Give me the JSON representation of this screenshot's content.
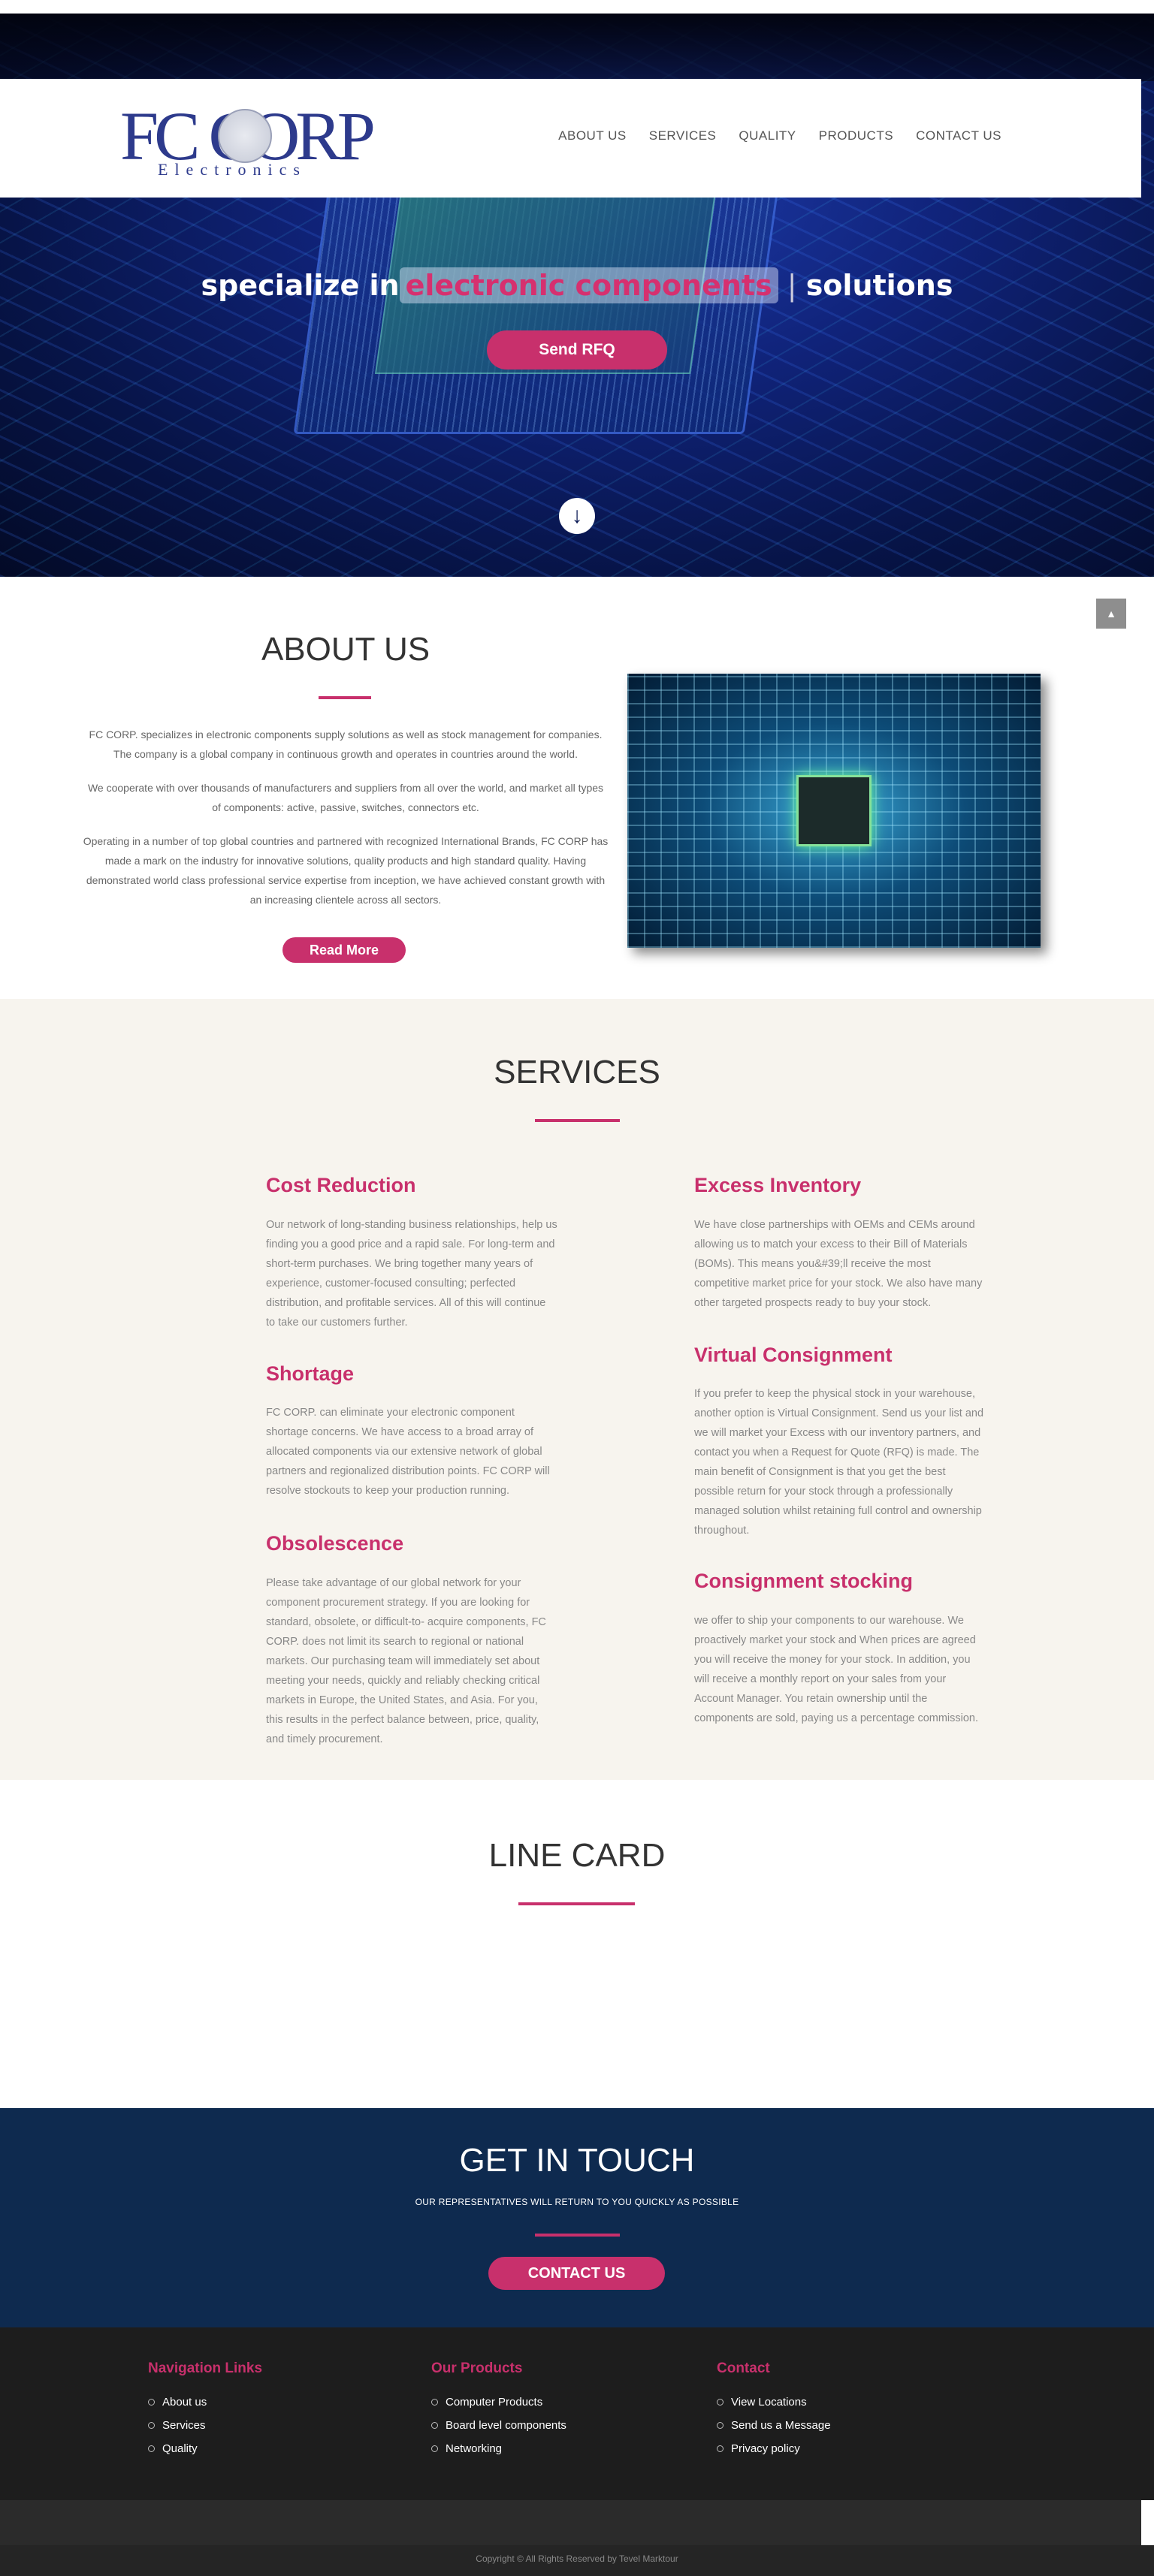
{
  "header": {
    "logo_main": "FC CORP",
    "logo_sub": "Electronics",
    "nav": [
      "ABOUT US",
      "SERVICES",
      "QUALITY",
      "PRODUCTS",
      "CONTACT US"
    ]
  },
  "hero": {
    "title_pre": "specialize in",
    "title_highlight": "electronic components",
    "title_post": "solutions",
    "rfq_button": "Send RFQ",
    "down_icon": "arrow-down-circle"
  },
  "about": {
    "title": "ABOUT US",
    "paragraphs": [
      "FC CORP. specializes in electronic components supply solutions as well as stock management for companies. The company is a global company in continuous growth and operates in countries around the world.",
      "We cooperate with over thousands of manufacturers and suppliers from all over the world, and market all types of components: active, passive, switches, connectors etc.",
      "Operating in a number of top global countries and partnered with recognized International Brands, FC CORP has made a mark on the industry for innovative solutions, quality products and high standard quality. Having demonstrated world class professional service expertise from inception, we have achieved constant growth with an increasing clientele across all sectors."
    ],
    "read_more": "Read More",
    "scroll_top_icon": "chevron-up"
  },
  "services": {
    "title": "SERVICES",
    "left": [
      {
        "title": "Cost Reduction",
        "text": "Our network of long-standing business relationships, help us finding you a good price and a rapid sale. For long-term and short-term purchases. We bring together many years of experience, customer-focused consulting; perfected distribution, and profitable services. All of this will continue to take our customers further."
      },
      {
        "title": "Shortage",
        "text": "FC CORP. can eliminate your electronic component shortage concerns. We have access to a broad array of allocated components via our extensive network of global partners and regionalized distribution points. FC CORP will resolve stockouts to keep your production running."
      },
      {
        "title": "Obsolescence",
        "text": "Please take advantage of our global network for your component procurement strategy. If you are looking for standard, obsolete, or difficult-to- acquire components, FC CORP. does not limit its search to regional or national markets. Our purchasing team will immediately set about meeting your needs, quickly and reliably checking critical markets in Europe, the United States, and Asia. For you, this results in the perfect balance between, price, quality, and timely procurement."
      }
    ],
    "right": [
      {
        "title": "Excess Inventory",
        "text": "We have close partnerships with OEMs and CEMs around allowing us to match your excess to their Bill of Materials (BOMs). This means you&#39;ll receive the most competitive market price for your stock. We also have many other targeted prospects ready to buy your stock."
      },
      {
        "title": "Virtual Consignment",
        "text": "If you prefer to keep the physical stock in your warehouse, another option is Virtual Consignment. Send us your list and we will market your Excess with our inventory partners, and contact you when a Request for Quote (RFQ) is made. The main benefit of Consignment is that you get the best possible return for your stock through a professionally managed solution whilst retaining full control and ownership throughout."
      },
      {
        "title": "Consignment stocking",
        "text": "we offer to ship your components to our warehouse. We proactively market your stock and When prices are agreed you will receive the money for your stock. In addition, you will receive a monthly report on your sales from your Account Manager. You retain ownership until the components are sold, paying us a percentage commission."
      }
    ]
  },
  "linecard": {
    "title": "LINE CARD"
  },
  "contact": {
    "title": "GET IN TOUCH",
    "subtitle": "OUR REPRESENTATIVES WILL RETURN TO YOU QUICKLY AS POSSIBLE",
    "button": "CONTACT US"
  },
  "footer": {
    "columns": [
      {
        "title": "Navigation Links",
        "items": [
          "About us",
          "Services",
          "Quality"
        ]
      },
      {
        "title": "Our Products",
        "items": [
          "Computer Products",
          "Board level components",
          "Networking"
        ]
      },
      {
        "title": "Contact",
        "items": [
          "View Locations",
          "Send us a Message",
          "Privacy policy"
        ]
      }
    ],
    "copyright": "Copyright © All Rights Reserved by Tevel Marktour"
  },
  "colors": {
    "accent": "#c8306c",
    "navy": "#0e2a4f",
    "footer": "#1d1d1d",
    "services_bg": "#f7f4ee"
  }
}
